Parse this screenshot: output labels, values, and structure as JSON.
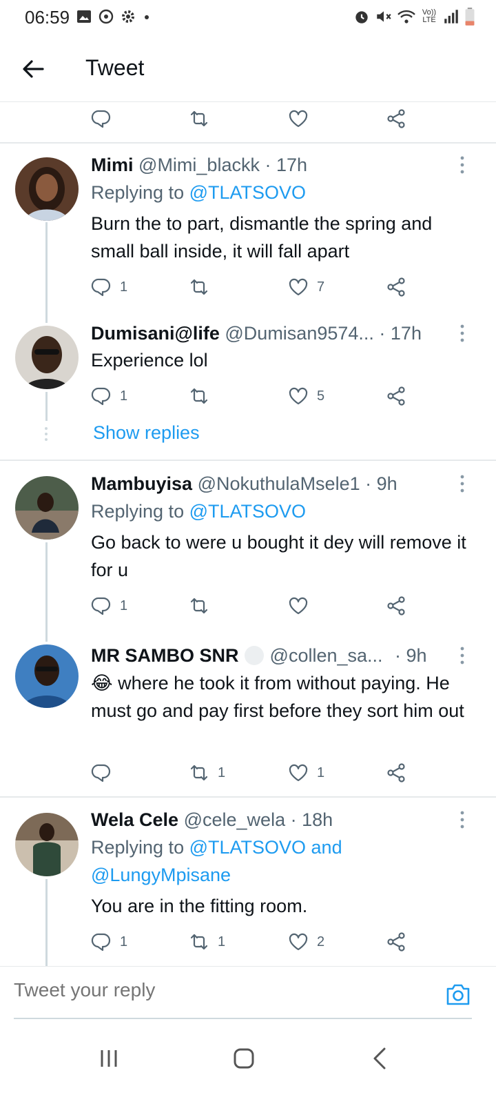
{
  "status": {
    "time": "06:59",
    "left_icons": [
      "image-icon",
      "sync-icon",
      "settings-icon",
      "dot-icon"
    ],
    "right_icons": [
      "alarm-icon",
      "mute-icon",
      "wifi-icon",
      "volte-icon",
      "signal-icon",
      "battery-icon"
    ],
    "volte_label": "Vo)) LTE"
  },
  "header": {
    "title": "Tweet"
  },
  "tweets": [
    {
      "name": "Mimi",
      "handle": "@Mimi_blackk",
      "time": "· 17h",
      "replying_prefix": "Replying to ",
      "replying_to": "@TLATSOVO",
      "body": "Burn the to part, dismantle the spring and small ball inside, it will fall apart",
      "replies": "1",
      "retweets": "",
      "likes": "7"
    },
    {
      "name": "Dumisani@life",
      "handle": "@Dumisan9574...",
      "time": "· 17h",
      "body": "Experience lol",
      "replies": "1",
      "retweets": "",
      "likes": "5"
    },
    {
      "name": "Mambuyisa",
      "handle": "@NokuthulaMsele1",
      "time": "· 9h",
      "replying_prefix": "Replying to ",
      "replying_to": "@TLATSOVO",
      "body": "Go back to were u bought it dey will remove it for u",
      "replies": "1",
      "retweets": "",
      "likes": ""
    },
    {
      "name": "MR SAMBO SNR",
      "handle": "@collen_sa...",
      "time": "· 9h",
      "emoji": "😂",
      "body": "where he took it from without paying. He must go and pay first before they sort him out",
      "replies": "",
      "retweets": "1",
      "likes": "1"
    },
    {
      "name": "Wela Cele",
      "handle": "@cele_wela",
      "time": "· 18h",
      "replying_prefix": "Replying to ",
      "replying_to": "@TLATSOVO and",
      "replying_to_2": "@LungyMpisane",
      "body": "You are in the fitting room.",
      "replies": "1",
      "retweets": "1",
      "likes": "2"
    }
  ],
  "show_replies": "Show replies",
  "reply_bar": {
    "placeholder": "Tweet your reply"
  },
  "colors": {
    "accent": "#1d9bf0",
    "muted": "#536471",
    "text": "#0f1419",
    "divider": "#e6e9eb"
  }
}
